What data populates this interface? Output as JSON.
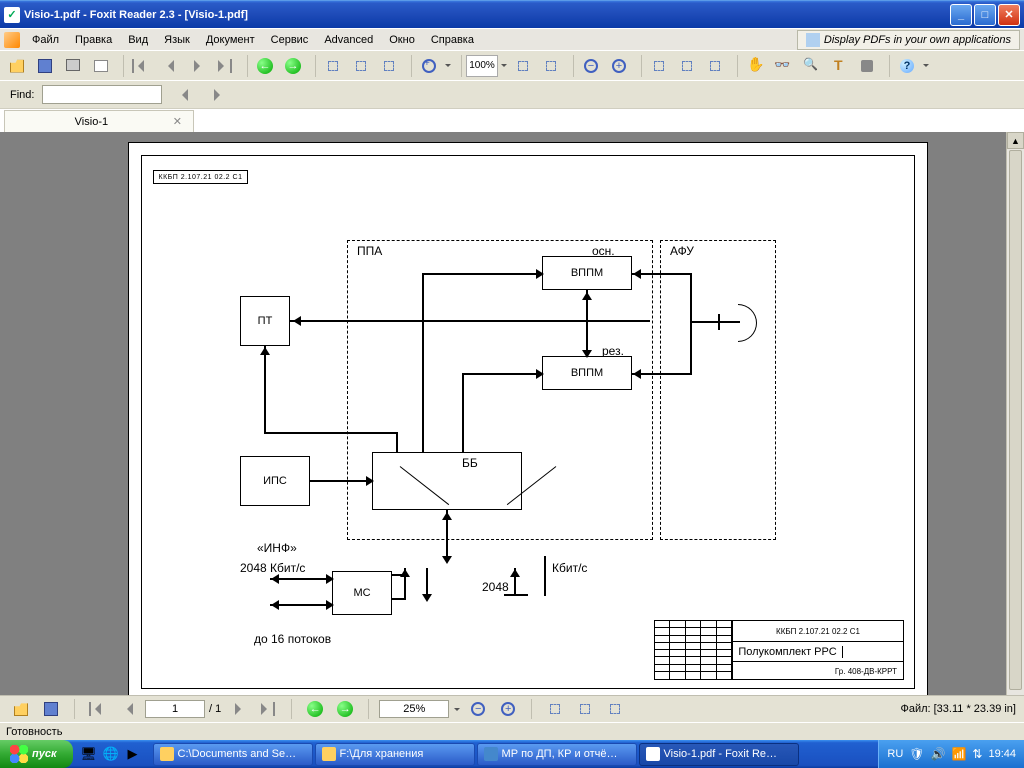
{
  "window": {
    "title": "Visio-1.pdf - Foxit Reader 2.3 - [Visio-1.pdf]"
  },
  "menu": {
    "items": [
      "Файл",
      "Правка",
      "Вид",
      "Язык",
      "Документ",
      "Сервис",
      "Advanced",
      "Окно",
      "Справка"
    ],
    "ad": "Display PDFs in your own applications"
  },
  "findbar": {
    "label": "Find:",
    "value": ""
  },
  "tab": {
    "label": "Visio-1"
  },
  "nav": {
    "page_field": "1",
    "page_total": "/ 1",
    "zoom": "25%",
    "size_label": "Файл: [33.11 * 23.39 in]"
  },
  "status": {
    "ready": "Готовность"
  },
  "zoom100": "100%",
  "diagram": {
    "ppa": "ППА",
    "osn": "осн.",
    "afu": "АФУ",
    "pt": "ПТ",
    "vppm": "ВППМ",
    "rez": "рез.",
    "ips": "ИПС",
    "bb": "ББ",
    "inf": "«ИНФ»",
    "rate": "2048 Кбит/с",
    "ms": "МС",
    "streams": "до 16 потоков",
    "kbs": "Кбит/с",
    "num2048": "2048",
    "stamp_code": "ККБП 2.107.21 02.2 С1",
    "stamp_mid": "Полукомплект РРС",
    "stamp_low": "Гр. 408-ДВ-КРРТ",
    "siderot": "ККБП 2.107.21 02.2 С1"
  },
  "taskbar": {
    "start": "пуск",
    "items": [
      "C:\\Documents and Se…",
      "F:\\Для хранения",
      "МР по ДП, КР и отчё…",
      "Visio-1.pdf - Foxit Re…"
    ],
    "lang": "RU",
    "clock": "19:44"
  }
}
